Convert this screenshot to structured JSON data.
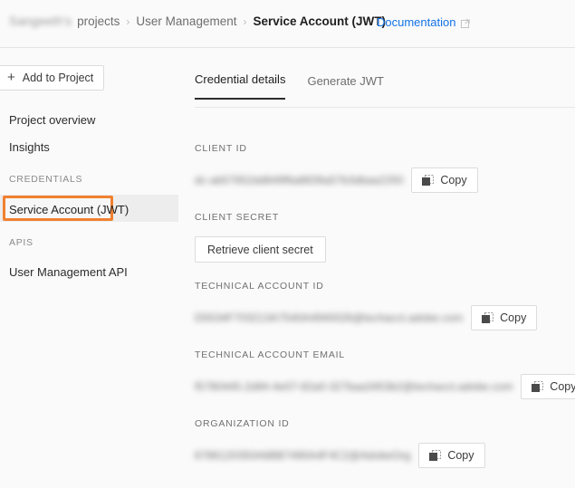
{
  "topbar": {
    "breadcrumb": [
      {
        "label": "Sangeeth's",
        "style": "blurred"
      },
      {
        "label": "projects",
        "style": "normal"
      },
      {
        "label": "User Management",
        "style": "normal"
      },
      {
        "label": "Service Account (JWT)",
        "style": "current"
      }
    ],
    "separator": "›",
    "documentation_label": "Documentation",
    "documentation_icon": "external-link-icon"
  },
  "sidebar": {
    "add_button": {
      "label": "Add to Project",
      "icon": "plus-icon"
    },
    "items": [
      {
        "label": "Project overview"
      },
      {
        "label": "Insights"
      }
    ],
    "credentials_heading": "CREDENTIALS",
    "credential_item": {
      "label": "Service Account (JWT)",
      "selected": true
    },
    "apis_heading": "APIS",
    "api_item": {
      "label": "User Management API"
    },
    "highlight_color": "#f08030",
    "selected_row_bg": "#ededed"
  },
  "main": {
    "tabs": [
      {
        "label": "Credential details",
        "active": true
      },
      {
        "label": "Generate JWT",
        "active": false
      }
    ],
    "copy_label": "Copy",
    "copy_icon": "copy-icon",
    "fields": [
      {
        "label": "CLIENT ID",
        "value": "dc-ab57652dd849f6a8839a57b3dbaa2250",
        "redacted": true,
        "action": "copy"
      },
      {
        "label": "CLIENT SECRET",
        "value": "",
        "redacted": false,
        "action": "retrieve",
        "button_label": "Retrieve client secret"
      },
      {
        "label": "TECHNICAL ACCOUNT ID",
        "value": "D5534F703213A7540A4940026@techacct.adobe.com",
        "redacted": true,
        "action": "copy"
      },
      {
        "label": "TECHNICAL ACCOUNT EMAIL",
        "value": "f5780445-2d94-4e07-82a0-327baa3453b2@techacct.adobe.com",
        "redacted": true,
        "action": "copy"
      },
      {
        "label": "ORGANIZATION ID",
        "value": "6786120350A6BB7490A4F4C2@AdobeOrg",
        "redacted": true,
        "action": "copy"
      }
    ]
  }
}
